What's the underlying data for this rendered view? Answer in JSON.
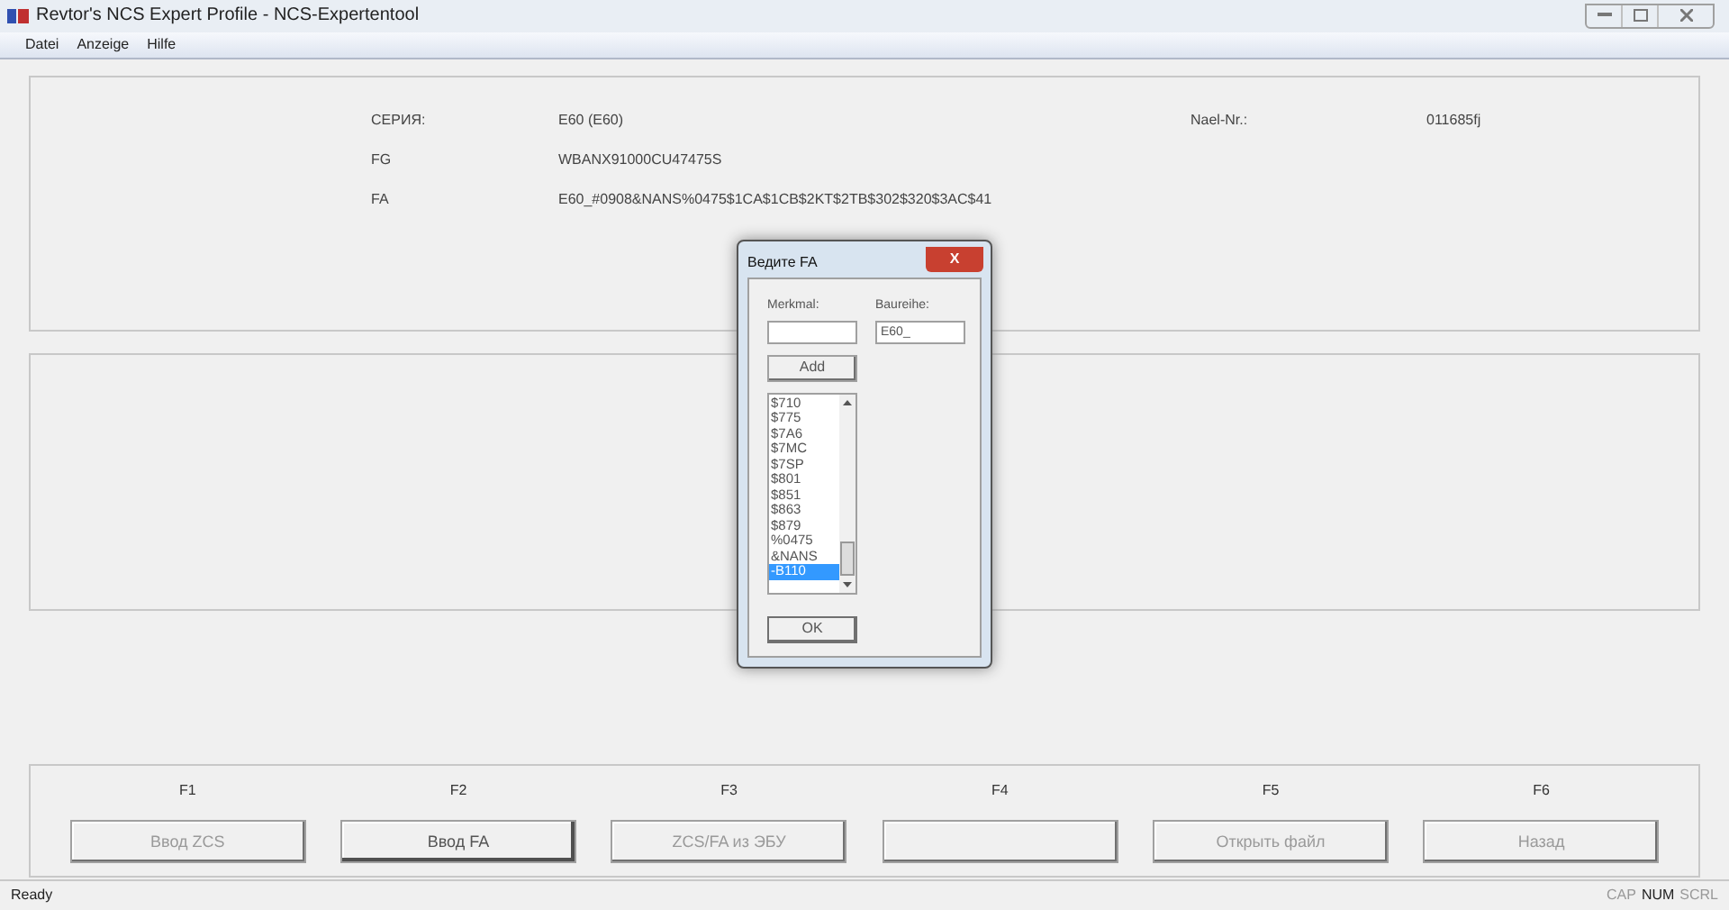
{
  "window": {
    "title": "Revtor's NCS Expert Profile - NCS-Expertentool"
  },
  "menu": [
    "Datei",
    "Anzeige",
    "Hilfe"
  ],
  "info": {
    "rows": [
      {
        "label": "СЕРИЯ:",
        "value": "E60 (E60)"
      },
      {
        "label": "FG",
        "value": "WBANX91000CU47475S"
      },
      {
        "label": "FA",
        "value": "E60_#0908&NANS%0475$1CA$1CB$2KT$2TB$302$320$3AC$41"
      }
    ],
    "extra": {
      "label": "Nael-Nr.:",
      "value": "011685fj"
    }
  },
  "function_keys": [
    {
      "key": "F1",
      "label": "Ввод ZCS",
      "disabled": true
    },
    {
      "key": "F2",
      "label": "Ввод FA",
      "disabled": false
    },
    {
      "key": "F3",
      "label": "ZCS/FA из ЭБУ",
      "disabled": true
    },
    {
      "key": "F4",
      "disabled": true
    },
    {
      "key": "F5",
      "label": "Открыть файл",
      "disabled": true
    },
    {
      "key": "F6",
      "label": "Назад",
      "disabled": true
    }
  ],
  "status_bar": {
    "text": "Ready",
    "indicators": [
      {
        "label": "CAP",
        "on": false
      },
      {
        "label": "NUM",
        "on": true
      },
      {
        "label": "SCRL",
        "on": false
      }
    ]
  },
  "dialog": {
    "title": "Ведите FA",
    "merkmal_label": "Merkmal:",
    "baureihe_label": "Baureihe:",
    "baureihe_value": "E60_",
    "add_button": "Add",
    "ok_button": "OK",
    "close": "X",
    "items": [
      {
        "text": "$710",
        "selected": false
      },
      {
        "text": "$775",
        "selected": false
      },
      {
        "text": "$7A6",
        "selected": false
      },
      {
        "text": "$7MC",
        "selected": false
      },
      {
        "text": "$7SP",
        "selected": false
      },
      {
        "text": "$801",
        "selected": false
      },
      {
        "text": "$851",
        "selected": false
      },
      {
        "text": "$863",
        "selected": false
      },
      {
        "text": "$879",
        "selected": false
      },
      {
        "text": "%0475",
        "selected": false
      },
      {
        "text": "&NANS",
        "selected": false
      },
      {
        "text": "-B110",
        "selected": true
      }
    ]
  }
}
